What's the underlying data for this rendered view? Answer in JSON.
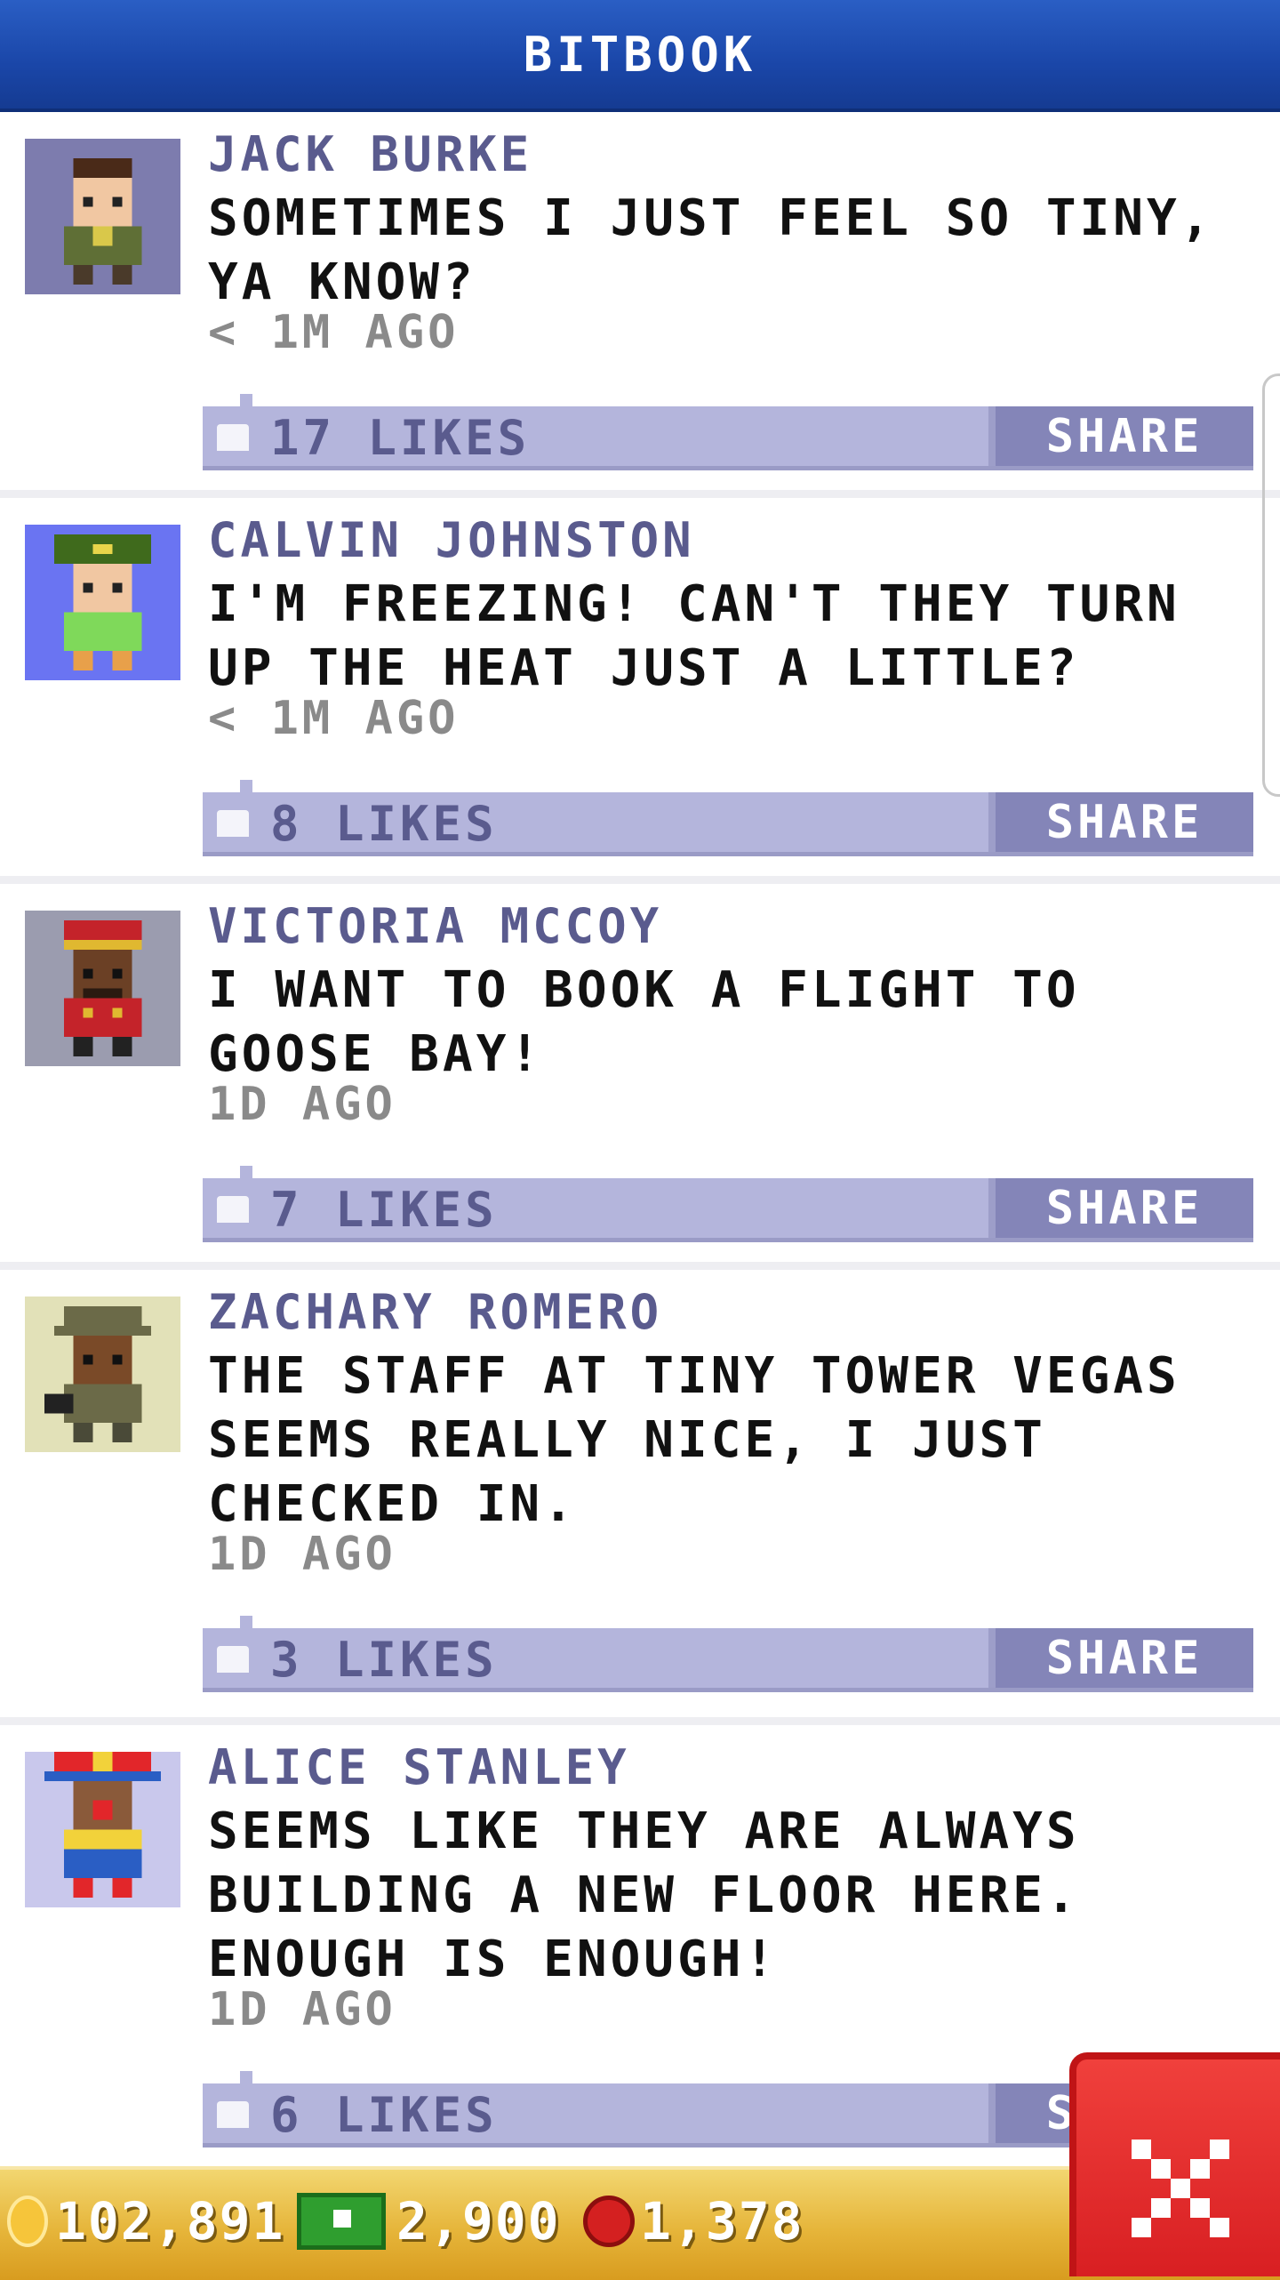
{
  "header": {
    "title": "BITBOOK"
  },
  "posts": [
    {
      "name": "JACK BURKE",
      "text": "SOMETIMES I JUST FEEL SO TINY, YA KNOW?",
      "time": "< 1M AGO",
      "likes": "17 LIKES",
      "share": "SHARE"
    },
    {
      "name": "CALVIN JOHNSTON",
      "text": "I'M FREEZING! CAN'T THEY TURN UP THE HEAT JUST A LITTLE?",
      "time": "< 1M AGO",
      "likes": "8 LIKES",
      "share": "SHARE"
    },
    {
      "name": "VICTORIA MCCOY",
      "text": "I WANT TO BOOK A FLIGHT TO GOOSE BAY!",
      "time": "1D AGO",
      "likes": "7 LIKES",
      "share": "SHARE"
    },
    {
      "name": "ZACHARY ROMERO",
      "text": "THE STAFF AT TINY TOWER VEGAS SEEMS REALLY NICE, I JUST CHECKED IN.",
      "time": "1D AGO",
      "likes": "3 LIKES",
      "share": "SHARE"
    },
    {
      "name": "ALICE STANLEY",
      "text": "SEEMS LIKE THEY ARE ALWAYS BUILDING A NEW FLOOR HERE. ENOUGH IS ENOUGH!",
      "time": "1D AGO",
      "likes": "6 LIKES",
      "share": "SHARE"
    }
  ],
  "footer": {
    "coins": "102,891",
    "bux": "2,900",
    "gems": "1,378"
  },
  "colors": {
    "header": "#1a46a8",
    "likes_bar": "#b4b5dc",
    "share_button": "#8485b8",
    "name_text": "#5a5b8e",
    "close_button": "#e0282a",
    "footer": "#e6b53a"
  }
}
